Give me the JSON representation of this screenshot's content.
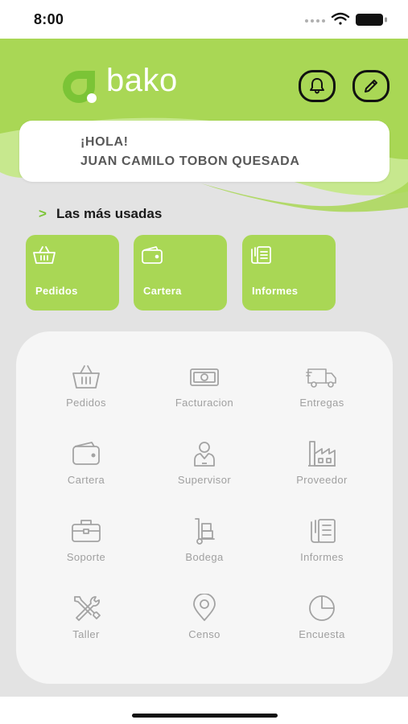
{
  "status": {
    "time": "8:00"
  },
  "brand": {
    "name": "bako",
    "accent": "#a9d755",
    "accent_light": "#c7e88e",
    "accent_dark": "#7bc436"
  },
  "header": {
    "bell_icon": "bell-icon",
    "edit_icon": "pencil-icon"
  },
  "greeting": {
    "hola": "¡HOLA!",
    "name": "JUAN CAMILO TOBON QUESADA"
  },
  "most_used": {
    "chevron": ">",
    "title": "Las más usadas",
    "tiles": [
      {
        "label": "Pedidos",
        "icon": "basket-icon"
      },
      {
        "label": "Cartera",
        "icon": "wallet-icon"
      },
      {
        "label": "Informes",
        "icon": "report-icon"
      }
    ]
  },
  "modules": [
    {
      "label": "Pedidos",
      "icon": "basket-icon"
    },
    {
      "label": "Facturacion",
      "icon": "banknote-icon"
    },
    {
      "label": "Entregas",
      "icon": "truck-icon"
    },
    {
      "label": "Cartera",
      "icon": "wallet-icon"
    },
    {
      "label": "Supervisor",
      "icon": "person-icon"
    },
    {
      "label": "Proveedor",
      "icon": "factory-icon"
    },
    {
      "label": "Soporte",
      "icon": "briefcase-icon"
    },
    {
      "label": "Bodega",
      "icon": "hand-truck-icon"
    },
    {
      "label": "Informes",
      "icon": "report-icon"
    },
    {
      "label": "Taller",
      "icon": "tools-icon"
    },
    {
      "label": "Censo",
      "icon": "location-pin-icon"
    },
    {
      "label": "Encuesta",
      "icon": "pie-chart-icon"
    }
  ]
}
